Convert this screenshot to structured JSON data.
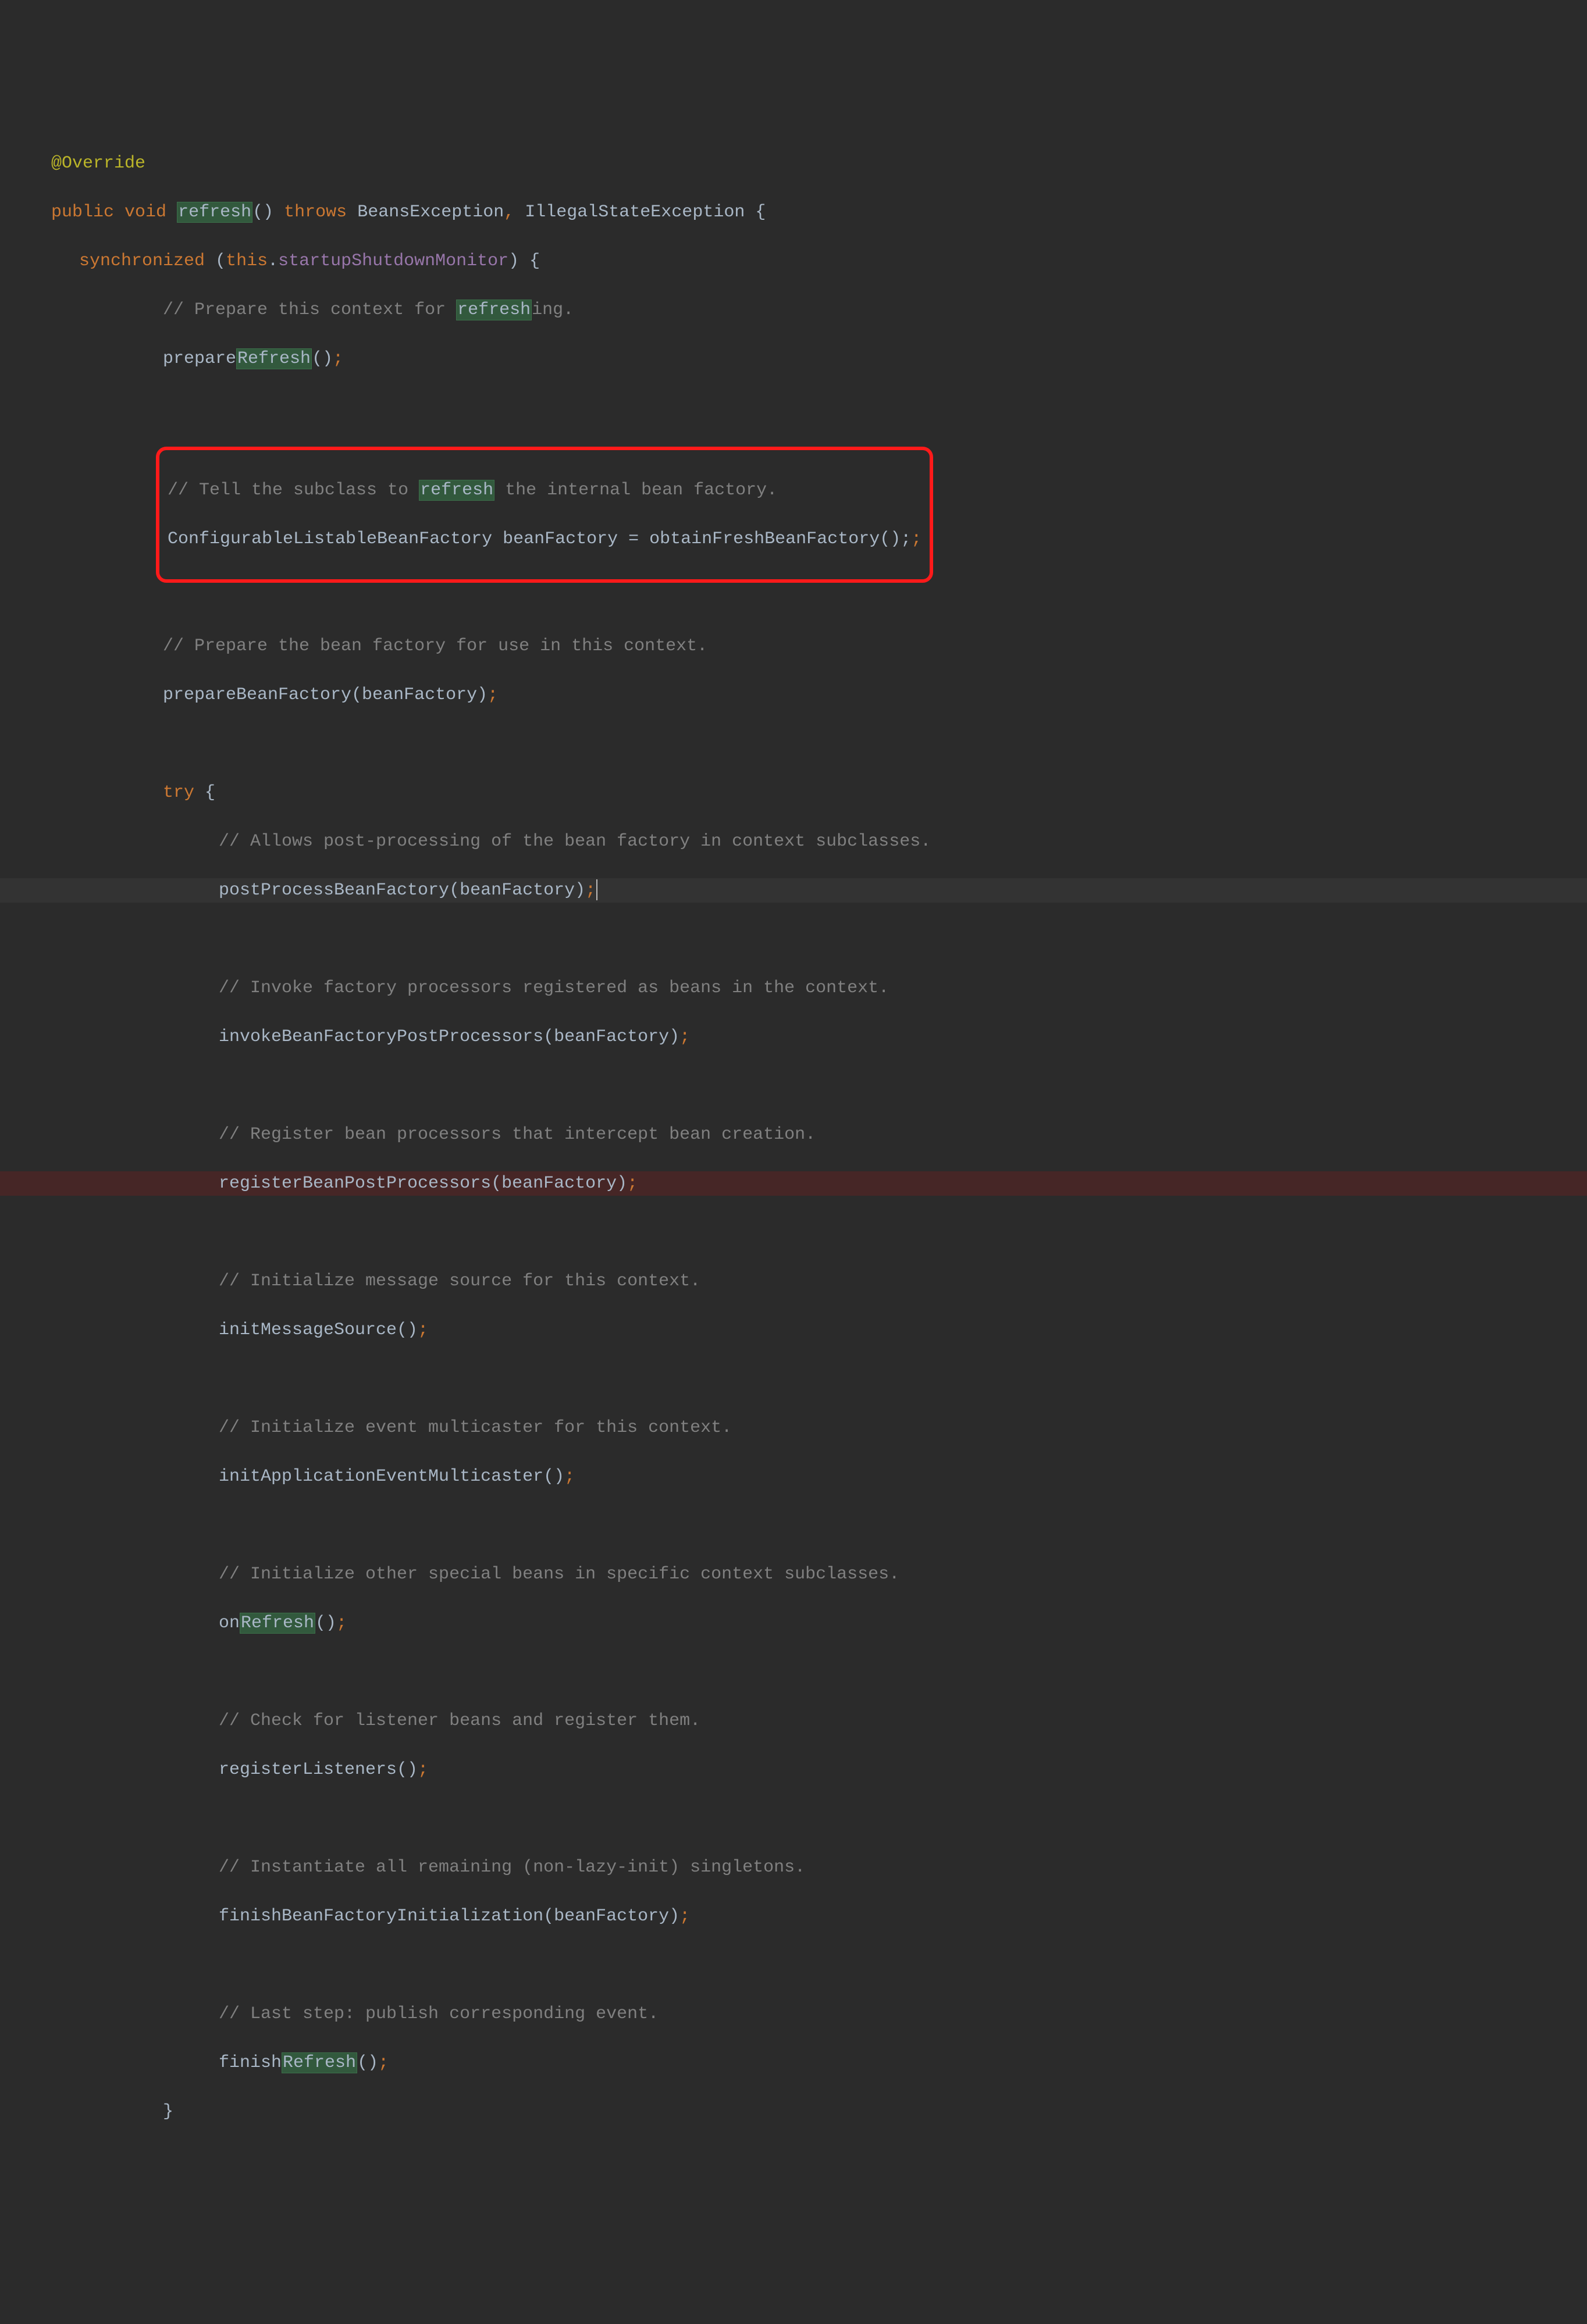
{
  "annotation": "@Override",
  "sig": {
    "kw_public": "public",
    "kw_void": "void",
    "name": "refresh",
    "parens": "()",
    "kw_throws": "throws",
    "exc1": "BeansException",
    "exc2": "IllegalStateException",
    "open": " {"
  },
  "sync": {
    "kw": "synchronized",
    "open_paren": " (",
    "this": "this",
    "dot": ".",
    "field": "startupShutdownMonitor",
    "close": ") {"
  },
  "c1a": "// Prepare this context for ",
  "c1b": "refresh",
  "c1c": "ing.",
  "prepRefresh_a": "prepare",
  "prepRefresh_b": "Refresh",
  "prepRefresh_c": "();",
  "c2a": "// Tell the subclass to ",
  "c2b": "refresh",
  "c2c": " the internal bean factory.",
  "obtain": "ConfigurableListableBeanFactory beanFactory = obtainFreshBeanFactory();",
  "c3": "// Prepare the bean factory for use in this context.",
  "prepBF": "prepareBeanFactory(beanFactory)",
  "semi": ";",
  "try": "try",
  "try_open": " {",
  "c4": "// Allows post-processing of the bean factory in context subclasses.",
  "postProcBF": "postProcessBeanFactory(beanFactory)",
  "c5": "// Invoke factory processors registered as beans in the context.",
  "invokeBFPP": "invokeBeanFactoryPostProcessors(beanFactory)",
  "c6": "// Register bean processors that intercept bean creation.",
  "regBPP": "registerBeanPostProcessors(beanFactory)",
  "c7": "// Initialize message source for this context.",
  "initMsg": "initMessageSource()",
  "c8": "// Initialize event multicaster for this context.",
  "initMulti": "initApplicationEventMulticaster()",
  "c9": "// Initialize other special beans in specific context subclasses.",
  "onRefresh_a": "on",
  "onRefresh_b": "Refresh",
  "onRefresh_c": "()",
  "c10": "// Check for listener beans and register them.",
  "regList": "registerListeners()",
  "c11": "// Instantiate all remaining (non-lazy-init) singletons.",
  "finishBFI": "finishBeanFactoryInitialization(beanFactory)",
  "c12": "// Last step: publish corresponding event.",
  "finishRefresh_a": "finish",
  "finishRefresh_b": "Refresh",
  "finishRefresh_c": "()",
  "close_try": "}"
}
